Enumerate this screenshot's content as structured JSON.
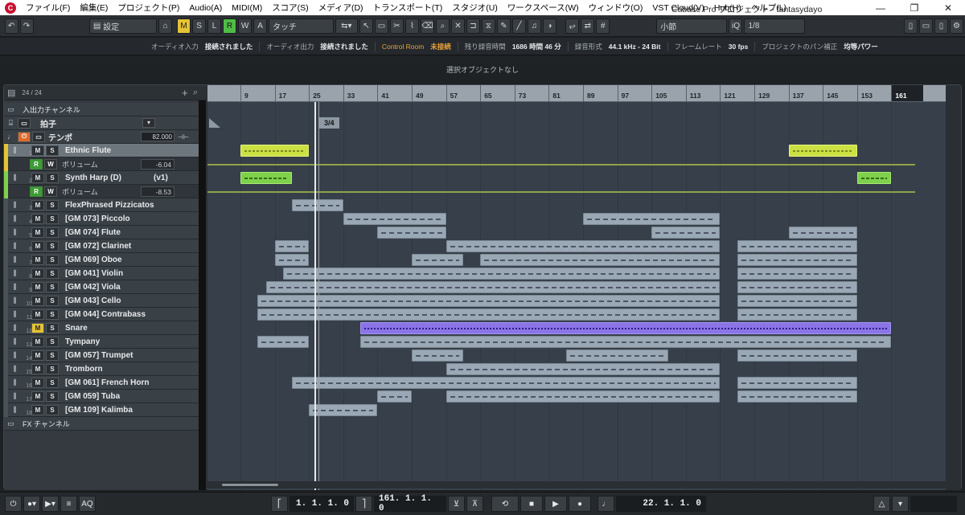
{
  "window": {
    "title": "Cubase Pro プロジェクト - fantasydayo",
    "app_logo": "C"
  },
  "menu": [
    "ファイル(F)",
    "編集(E)",
    "プロジェクト(P)",
    "Audio(A)",
    "MIDI(M)",
    "スコア(S)",
    "メディア(D)",
    "トランスポート(T)",
    "スタジオ(U)",
    "ワークスペース(W)",
    "ウィンドウ(O)",
    "VST Cloud(V)",
    "Hub(H)",
    "ヘルプ(L)"
  ],
  "toolbar": {
    "setting_label": "設定",
    "mode_buttons": [
      "M",
      "S",
      "L",
      "R",
      "W",
      "A"
    ],
    "automation_mode": "タッチ",
    "grid_type": "小節",
    "quantize_value": "1/8",
    "iq_label": "iQ"
  },
  "infoline": {
    "audio_in_label": "オーディオ入力",
    "audio_in_val": "接続されました",
    "audio_out_label": "オーディオ出力",
    "audio_out_val": "接続されました",
    "control_room_label": "Control Room",
    "control_room_val": "未接続",
    "rec_time_label": "残り録音時間",
    "rec_time_val": "1686 時間 46 分",
    "rec_format_label": "録音形式",
    "rec_format_val": "44.1 kHz - 24 Bit",
    "frame_rate_label": "フレームレート",
    "frame_rate_val": "30 fps",
    "pan_label": "プロジェクトのパン補正",
    "pan_val": "均等パワー"
  },
  "inspector_text": "選択オブジェクトなし",
  "tracklist": {
    "count": "24 / 24",
    "io_channel": "入出力チャンネル",
    "signature": "拍子",
    "tempo": "テンポ",
    "tempo_value": "82.000",
    "fx_channel": "FX チャンネル",
    "volume_label": "ボリューム"
  },
  "tracks": [
    {
      "num": "1",
      "name": "Ethnic Flute",
      "color": "#e4c335",
      "volume": "-6.04"
    },
    {
      "num": "2",
      "name": "Synth Harp (D)",
      "extra": "(v1)",
      "color": "#7fd04b",
      "volume": "-8.53"
    },
    {
      "num": "3",
      "name": "FlexPhrased Pizzicatos"
    },
    {
      "num": "4",
      "name": "[GM 073] Piccolo"
    },
    {
      "num": "5",
      "name": "[GM 074] Flute"
    },
    {
      "num": "6",
      "name": "[GM 072] Clarinet"
    },
    {
      "num": "7",
      "name": "[GM 069] Oboe"
    },
    {
      "num": "8",
      "name": "[GM 041] Violin"
    },
    {
      "num": "9",
      "name": "[GM 042] Viola"
    },
    {
      "num": "10",
      "name": "[GM 043] Cello"
    },
    {
      "num": "11",
      "name": "[GM 044] Contrabass"
    },
    {
      "num": "12",
      "name": "Snare"
    },
    {
      "num": "13",
      "name": "Tympany"
    },
    {
      "num": "14",
      "name": "[GM 057] Trumpet"
    },
    {
      "num": "15",
      "name": "Tromborn"
    },
    {
      "num": "16",
      "name": "[GM 061] French Horn"
    },
    {
      "num": "17",
      "name": "[GM 059] Tuba"
    },
    {
      "num": "18",
      "name": "[GM 109] Kalimba"
    }
  ],
  "ruler": [
    "9",
    "17",
    "25",
    "33",
    "41",
    "49",
    "57",
    "65",
    "73",
    "81",
    "89",
    "97",
    "105",
    "113",
    "121",
    "129",
    "137",
    "145",
    "153",
    "161"
  ],
  "signature_marker": "3/4",
  "transport": {
    "left_locator": "1. 1. 1.   0",
    "right_locator": "161. 1. 1.   0",
    "position": "22. 1. 1.   0",
    "aq_label": "AQ"
  }
}
